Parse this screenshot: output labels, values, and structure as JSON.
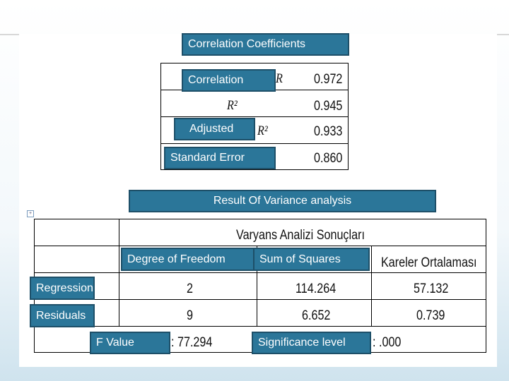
{
  "correlation": {
    "title": "Correlation Coefficients",
    "rows": [
      {
        "label": "Correlation",
        "symbol": "R",
        "value": "0.972"
      },
      {
        "label": "",
        "symbol": "R²",
        "value": "0.945"
      },
      {
        "label": "Adjusted",
        "symbol": "R²",
        "value": "0.933"
      },
      {
        "label": "Standard Error",
        "symbol": "",
        "value": "0.860"
      }
    ]
  },
  "anova": {
    "title": "Result Of Variance analysis",
    "table_title": "Varyans Analizi Sonuçları",
    "headers": [
      "Degree of Freedom",
      "Sum of Squares",
      "Kareler Ortalaması"
    ],
    "rows": [
      {
        "label": "Regression",
        "df": "2",
        "ss": "114.264",
        "ms": "57.132"
      },
      {
        "label": "Residuals",
        "df": "9",
        "ss": "6.652",
        "ms": "0.739"
      }
    ],
    "f_label": "F Value",
    "f_value": ": 77.294",
    "sig_label": "Significance level",
    "sig_value": ": .000"
  },
  "colors": {
    "label_bg": "#2b7699",
    "label_border": "#1d4f68"
  }
}
